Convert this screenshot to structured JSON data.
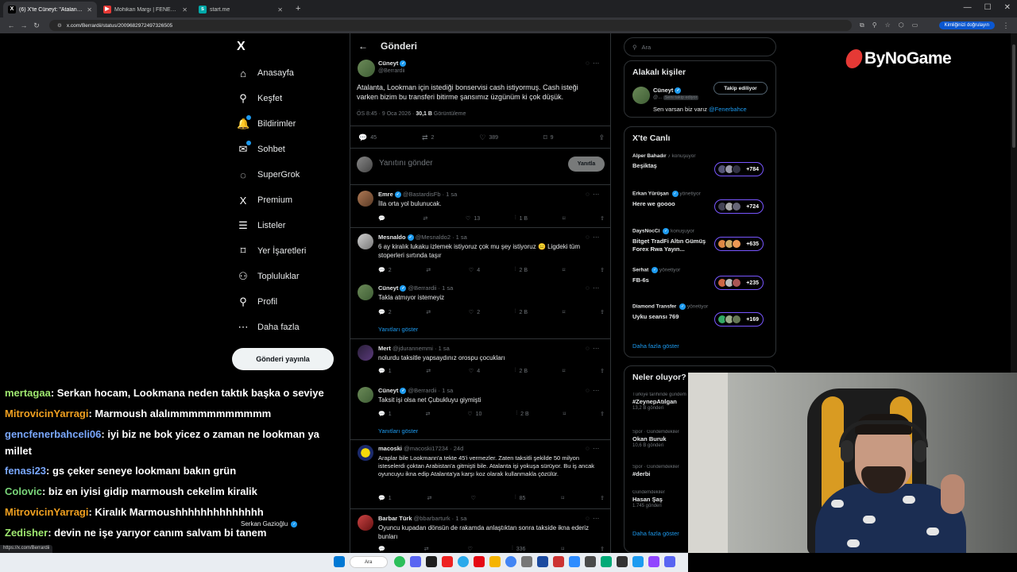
{
  "browser": {
    "tabs": [
      {
        "title": "(6) X'te Cüneyt: \"Atalanta, Lookm",
        "icon": "x-favicon",
        "active": true
      },
      {
        "title": "Mohikan Margı | FENERBAHÇE",
        "icon": "youtube-favicon",
        "active": false
      },
      {
        "title": "start.me",
        "icon": "startme-favicon",
        "active": false
      }
    ],
    "url": "x.com/Berrardii/status/2009682972497326505",
    "verify_label": "Kimliğinizi doğrulayın",
    "status_url": "https://x.com/Berrardii"
  },
  "sidebar": {
    "logo": "X",
    "items": [
      {
        "label": "Anasayfa",
        "icon": "home-icon",
        "glyph": "⌂"
      },
      {
        "label": "Keşfet",
        "icon": "search-icon",
        "glyph": "⚲"
      },
      {
        "label": "Bildirimler",
        "icon": "bell-icon",
        "glyph": "🔔"
      },
      {
        "label": "Sohbet",
        "icon": "mail-icon",
        "glyph": "✉"
      },
      {
        "label": "SuperGrok",
        "icon": "grok-icon",
        "glyph": "◌"
      },
      {
        "label": "Premium",
        "icon": "x-premium-icon",
        "glyph": "X"
      },
      {
        "label": "Listeler",
        "icon": "list-icon",
        "glyph": "☰"
      },
      {
        "label": "Yer İşaretleri",
        "icon": "bookmark-icon",
        "glyph": "🔖"
      },
      {
        "label": "Topluluklar",
        "icon": "communities-icon",
        "glyph": "👥"
      },
      {
        "label": "Profil",
        "icon": "profile-icon",
        "glyph": "👤"
      },
      {
        "label": "Daha fazla",
        "icon": "more-circle-icon",
        "glyph": "⋯"
      }
    ],
    "post_button": "Gönderi yayınla"
  },
  "main": {
    "header": "Gönderi",
    "post": {
      "name": "Cüneyt",
      "handle": "@Berrardii",
      "text": "Atalanta, Lookman için istediği bonservisi cash istiyormuş. Cash isteği varken bizim bu transferi bitirme şansımız üzgünüm ki çok düşük.",
      "time": "ÖS 8:45 · 9 Oca 2026 ·",
      "views": "30,1 B",
      "views_label": "Görüntüleme",
      "replies": "45",
      "reposts": "2",
      "likes": "389",
      "bookmarks": "9"
    },
    "reply_placeholder": "Yanıtını gönder",
    "reply_button": "Yanıtla",
    "replies": [
      {
        "name": "Emre",
        "handle": "@BastardisFb · 1 sa",
        "text": "İlla orta yol bulunucak.",
        "replies": "",
        "reposts": "",
        "likes": "13",
        "views": "1 B"
      },
      {
        "name": "Mesnaldo",
        "handle": "@Mesnaldo2 · 1 sa",
        "text": "6 ay kiralık lukaku izlemek istiyoruz çok mu şey istiyoruz 😑 Ligdeki tüm stoperleri sırtında taşır",
        "replies": "2",
        "reposts": "",
        "likes": "4",
        "views": "2 B"
      },
      {
        "name": "Cüneyt",
        "handle": "@Berrardii · 1 sa",
        "text": "Takla atmıyor istemeyiz",
        "replies": "2",
        "reposts": "",
        "likes": "2",
        "views": "2 B"
      },
      {
        "name": "Mert",
        "handle": "@jdurannemmi · 1 sa",
        "text": "nolurdu taksitle yapsaydınız orospu çocukları",
        "replies": "1",
        "reposts": "",
        "likes": "4",
        "views": "2 B"
      },
      {
        "name": "Cüneyt",
        "handle": "@Berrardii · 1 sa",
        "text": "Taksit işi olsa net Çubukluyu giymişti",
        "replies": "1",
        "reposts": "",
        "likes": "10",
        "views": "2 B"
      },
      {
        "name": "macoski",
        "handle": "@macoski17234 · 24d",
        "text": "Araplar bile Lookmann'a tekte 45'i vermezler. Zaten taksitli şekilde 50 milyon isteselerdi çoktan Arabistan'a gitmişti bile. Atalanta işi yokuşa sürüyor. Bu iş ancak oyuncuyu ikna edip Atalanta'ya karşı koz olarak kullanmakla çözülür.",
        "replies": "1",
        "reposts": "",
        "likes": "",
        "views": "85"
      },
      {
        "name": "Barbar Türk",
        "handle": "@bbarbarturk · 1 sa",
        "text": "Oyuncu kupadan dönsün de rakamda anlaştıktan sonra takside ikna ederiz bunları",
        "replies": "",
        "reposts": "",
        "likes": "",
        "views": "336"
      }
    ],
    "show_replies": "Yanıtları göster"
  },
  "right": {
    "search_placeholder": "Ara",
    "related_title": "Alakalı kişiler",
    "related_user": {
      "name": "Cüneyt",
      "handle": "@...",
      "badge": "Seni takip ediyor",
      "bio": "Sen varsan biz varız",
      "mention": "@Fenerbahce",
      "follow": "Takip ediliyor"
    },
    "live_title": "X'te Canlı",
    "live": [
      {
        "host": "Alper Bahadır",
        "role": "konuşuyor",
        "title": "Beşiktaş",
        "count": "+784"
      },
      {
        "host": "Erkan Yürüşan",
        "role": "yönetiyor",
        "title": "Here we goooo",
        "count": "+724"
      },
      {
        "host": "DaysNocCi",
        "role": "konuşuyor",
        "title": "Bitget TradFi Altın Gümüş Forex Rwa Yayın...",
        "count": "+635"
      },
      {
        "host": "Serhat",
        "role": "yönetiyor",
        "title": "FB-6s",
        "count": "+235"
      },
      {
        "host": "Diamond Transfer",
        "role": "yönetiyor",
        "title": "Uyku seansı 769",
        "count": "+169"
      }
    ],
    "more": "Daha fazla göster",
    "trends_title": "Neler oluyor?",
    "trends": [
      {
        "cat": "Türkiye tarihinde gündem",
        "title": "#ZeynepAtılgan",
        "count": "13,2 B gönderi"
      },
      {
        "cat": "Spor · Gündemdekiler",
        "title": "Okan Buruk",
        "count": "10,6 B gönderi"
      },
      {
        "cat": "Spor · Gündemdekiler",
        "title": "#derbi",
        "count": ""
      },
      {
        "cat": "Gündemdekiler",
        "title": "Hasan Şaş",
        "count": "1.745 gönderi"
      }
    ],
    "more2": "Daha fazla göster"
  },
  "overlay": {
    "brand": "ByNoGame",
    "chat": [
      {
        "user": "mertagaa",
        "color": "#9fe870",
        "msg": ": Serkan hocam, Lookmana neden taktık başka o seviye"
      },
      {
        "user": "MitrovicinYarragi",
        "color": "#f0a020",
        "msg": ": Marmoush alalımmmmmmmmmmm"
      },
      {
        "user": "gencfenerbahceli06",
        "color": "#7aa8ff",
        "msg": ": iyi biz ne bok yicez o zaman ne lookman ya"
      },
      {
        "user": "",
        "color": "#fff",
        "msg": "millet"
      },
      {
        "user": "fenasi23",
        "color": "#7aa8ff",
        "msg": ": gs çeker seneye lookmanı bakın grün"
      },
      {
        "user": "Colovic",
        "color": "#7ad67a",
        "msg": ": biz en iyisi gidip marmoush cekelim kiralik"
      },
      {
        "user": "MitrovicinYarragi",
        "color": "#f0a020",
        "msg": ": Kiralık Marmoushhhhhhhhhhhhhh"
      },
      {
        "user": "Zedisher",
        "color": "#9fe870",
        "msg": ": devin ne işe yarıyor canım salvam bi tanem"
      }
    ],
    "current_user": "Serkan Gazioğlu",
    "taskbar_search": "Ara"
  },
  "colors": {
    "accent": "#1d9bf0",
    "live_border": "#7856ff",
    "brand_red": "#e53935"
  }
}
